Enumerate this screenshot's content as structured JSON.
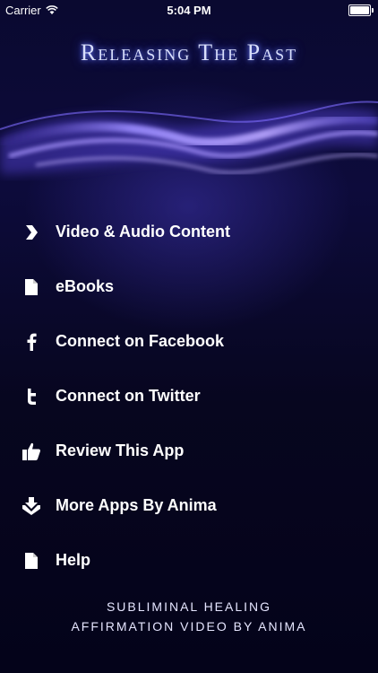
{
  "status_bar": {
    "carrier": "Carrier",
    "time": "5:04 PM",
    "battery_level": 1.0
  },
  "header": {
    "title": "Releasing The Past"
  },
  "menu": {
    "items": [
      {
        "label": "Video & Audio Content",
        "icon": "chevron-right-icon"
      },
      {
        "label": "eBooks",
        "icon": "document-icon"
      },
      {
        "label": "Connect on Facebook",
        "icon": "facebook-icon"
      },
      {
        "label": "Connect on Twitter",
        "icon": "twitter-icon"
      },
      {
        "label": "Review This App",
        "icon": "thumbs-up-icon"
      },
      {
        "label": "More Apps By Anima",
        "icon": "download-box-icon"
      },
      {
        "label": "Help",
        "icon": "document-icon"
      }
    ]
  },
  "footer": {
    "line1": "Subliminal Healing",
    "line2": "Affirmation Video by Anima"
  },
  "colors": {
    "background": "#06051f",
    "title_glow": "#6b7cff",
    "wave": "#7a6cff"
  }
}
